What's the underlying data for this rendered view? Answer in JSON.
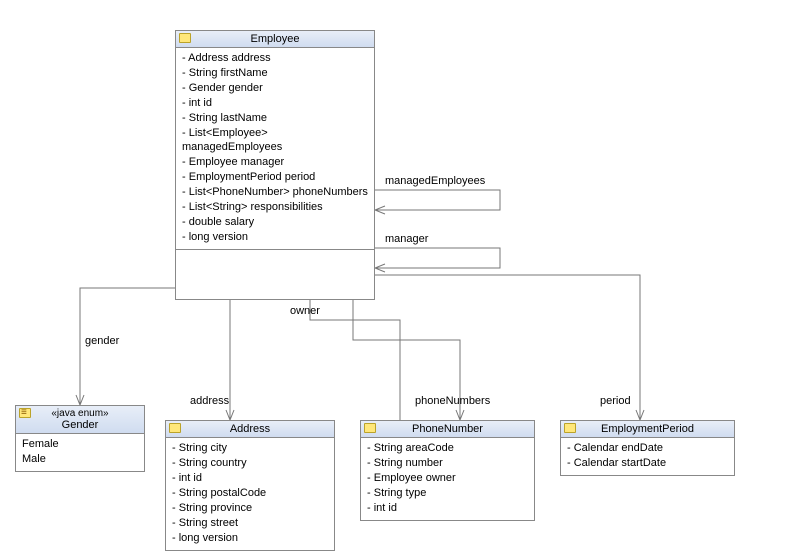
{
  "classes": {
    "employee": {
      "title": "Employee",
      "attrs": [
        "Address address",
        "String firstName",
        "Gender gender",
        "int id",
        "String lastName",
        "List<Employee> managedEmployees",
        "Employee manager",
        "EmploymentPeriod period",
        "List<PhoneNumber> phoneNumbers",
        "List<String> responsibilities",
        "double salary",
        "long version"
      ]
    },
    "gender": {
      "stereotype": "«java enum»",
      "title": "Gender",
      "literals": [
        "Female",
        "Male"
      ]
    },
    "address": {
      "title": "Address",
      "attrs": [
        "String city",
        "String country",
        "int id",
        "String postalCode",
        "String province",
        "String street",
        "long version"
      ]
    },
    "phoneNumber": {
      "title": "PhoneNumber",
      "attrs": [
        "String areaCode",
        "String number",
        "Employee owner",
        "String type",
        "int id"
      ]
    },
    "employmentPeriod": {
      "title": "EmploymentPeriod",
      "attrs": [
        "Calendar endDate",
        "Calendar startDate"
      ]
    }
  },
  "labels": {
    "managedEmployees": "managedEmployees",
    "manager": "manager",
    "gender": "gender",
    "owner": "owner",
    "address": "address",
    "phoneNumbers": "phoneNumbers",
    "period": "period"
  },
  "chart_data": {
    "type": "uml-class-diagram",
    "classes": [
      {
        "name": "Employee",
        "kind": "class",
        "attributes": [
          "Address address",
          "String firstName",
          "Gender gender",
          "int id",
          "String lastName",
          "List<Employee> managedEmployees",
          "Employee manager",
          "EmploymentPeriod period",
          "List<PhoneNumber> phoneNumbers",
          "List<String> responsibilities",
          "double salary",
          "long version"
        ]
      },
      {
        "name": "Gender",
        "kind": "enum",
        "stereotype": "«java enum»",
        "literals": [
          "Female",
          "Male"
        ]
      },
      {
        "name": "Address",
        "kind": "class",
        "attributes": [
          "String city",
          "String country",
          "int id",
          "String postalCode",
          "String province",
          "String street",
          "long version"
        ]
      },
      {
        "name": "PhoneNumber",
        "kind": "class",
        "attributes": [
          "String areaCode",
          "String number",
          "Employee owner",
          "String type",
          "int id"
        ]
      },
      {
        "name": "EmploymentPeriod",
        "kind": "class",
        "attributes": [
          "Calendar endDate",
          "Calendar startDate"
        ]
      }
    ],
    "associations": [
      {
        "from": "Employee",
        "to": "Employee",
        "role": "managedEmployees",
        "navigable": true
      },
      {
        "from": "Employee",
        "to": "Employee",
        "role": "manager",
        "navigable": true
      },
      {
        "from": "Employee",
        "to": "Gender",
        "role": "gender",
        "navigable": true
      },
      {
        "from": "Employee",
        "to": "Address",
        "role": "address",
        "navigable": true
      },
      {
        "from": "PhoneNumber",
        "to": "Employee",
        "role": "owner",
        "navigable": true
      },
      {
        "from": "Employee",
        "to": "PhoneNumber",
        "role": "phoneNumbers",
        "navigable": true
      },
      {
        "from": "Employee",
        "to": "EmploymentPeriod",
        "role": "period",
        "navigable": true
      }
    ]
  }
}
